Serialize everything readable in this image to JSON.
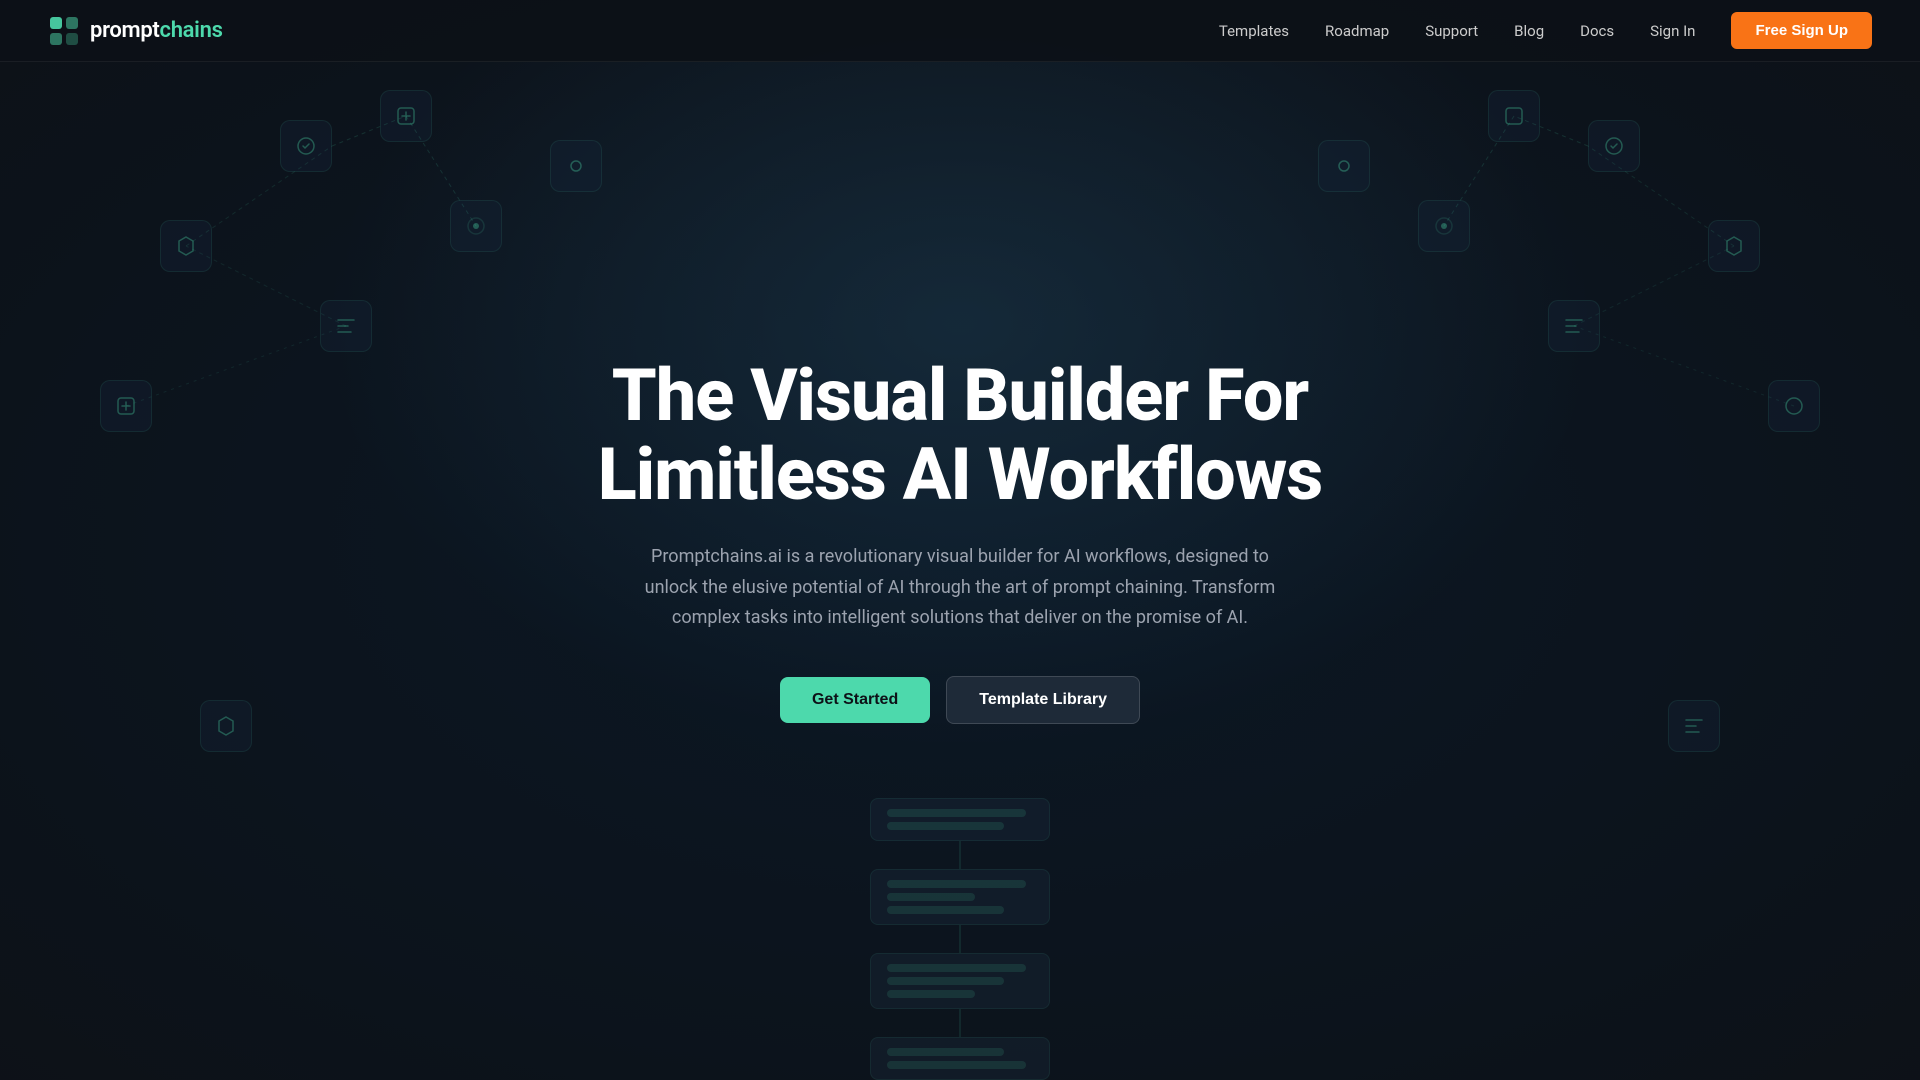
{
  "nav": {
    "logo": {
      "text_prompt": "prompt",
      "text_chains": "chains"
    },
    "links": [
      {
        "id": "templates",
        "label": "Templates"
      },
      {
        "id": "roadmap",
        "label": "Roadmap"
      },
      {
        "id": "support",
        "label": "Support"
      },
      {
        "id": "blog",
        "label": "Blog"
      },
      {
        "id": "docs",
        "label": "Docs"
      },
      {
        "id": "signin",
        "label": "Sign In"
      }
    ],
    "cta": {
      "label": "Free Sign Up"
    }
  },
  "hero": {
    "title_line1": "The Visual Builder For",
    "title_line2": "Limitless AI Workflows",
    "subtitle": "Promptchains.ai is a revolutionary visual builder for AI workflows, designed to unlock the elusive potential of AI through the art of prompt chaining. Transform complex tasks into intelligent solutions that deliver on the promise of AI.",
    "cta_primary": "Get Started",
    "cta_secondary": "Template Library"
  },
  "colors": {
    "accent_teal": "#4dd9ac",
    "accent_orange": "#f97316",
    "bg_dark": "#0d1117",
    "text_muted": "#9ca3af"
  }
}
